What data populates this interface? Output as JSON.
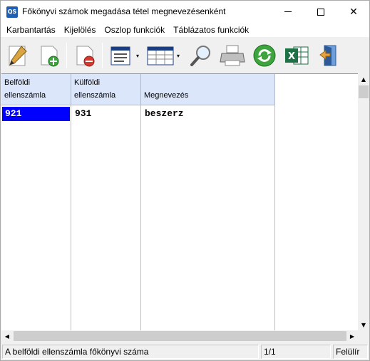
{
  "window": {
    "app_icon_text": "QS",
    "title": "Főkönyvi számok megadása tétel megnevezésenként",
    "close_glyph": "✕"
  },
  "menu": {
    "items": [
      "Karbantartás",
      "Kijelölés",
      "Oszlop funkciók",
      "Táblázatos funkciók"
    ]
  },
  "toolbar": {
    "buttons": [
      {
        "icon": "edit-pencil-icon"
      },
      {
        "icon": "new-record-icon"
      },
      {
        "icon": "delete-record-icon"
      },
      {
        "icon": "list-view-icon"
      },
      {
        "icon": "table-view-icon"
      },
      {
        "icon": "search-magnifier-icon"
      },
      {
        "icon": "printer-icon"
      },
      {
        "icon": "refresh-icon"
      },
      {
        "icon": "excel-export-icon"
      },
      {
        "icon": "exit-door-icon"
      }
    ],
    "dropdown_glyph": "▾"
  },
  "grid": {
    "columns": [
      {
        "label_line1": "Belföldi",
        "label_line2": "ellenszámla"
      },
      {
        "label_line1": "Külföldi",
        "label_line2": "ellenszámla"
      },
      {
        "label_line1": "",
        "label_line2": "Megnevezés"
      }
    ],
    "rows": [
      [
        "921",
        "931",
        "beszerz"
      ]
    ]
  },
  "scrollbars": {
    "up": "▲",
    "down": "▼",
    "left": "◀",
    "right": "▶"
  },
  "statusbar": {
    "hint": "A belföldi ellenszámla főkönyvi száma",
    "position": "1/1",
    "mode": "Felülír"
  },
  "colors": {
    "selection": "#0000ff",
    "header_bg": "#dbe6fb"
  }
}
